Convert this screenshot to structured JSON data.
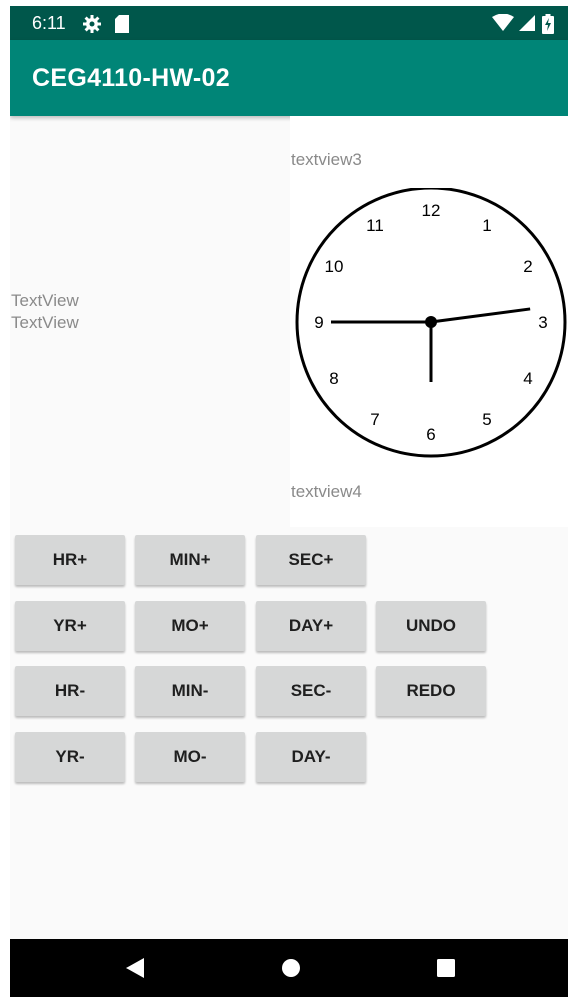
{
  "status_bar": {
    "time": "6:11",
    "icons": [
      "settings-icon",
      "sd-card-icon",
      "wifi-icon",
      "cell-signal-icon",
      "battery-charging-icon"
    ]
  },
  "app_bar": {
    "title": "CEG4110-HW-02"
  },
  "left_panel": {
    "textview1": "TextView",
    "textview2": "TextView"
  },
  "right_panel": {
    "textview3": "textview3",
    "textview4": "textview4",
    "clock": {
      "numbers": [
        "12",
        "1",
        "2",
        "3",
        "4",
        "5",
        "6",
        "7",
        "8",
        "9",
        "10",
        "11"
      ],
      "time_shown": {
        "hour": 2,
        "minute": 45,
        "second": 30
      }
    }
  },
  "buttons": {
    "row1": [
      "HR+",
      "MIN+",
      "SEC+"
    ],
    "row2": [
      "YR+",
      "MO+",
      "DAY+",
      "UNDO"
    ],
    "row3": [
      "HR-",
      "MIN-",
      "SEC-",
      "REDO"
    ],
    "row4": [
      "YR-",
      "MO-",
      "DAY-"
    ]
  },
  "nav_bar": {
    "icons": [
      "back-icon",
      "home-icon",
      "recents-icon"
    ]
  },
  "colors": {
    "status_bar": "#00574b",
    "app_bar": "#008577",
    "button_bg": "#d6d7d7",
    "nav_bar": "#000000"
  }
}
